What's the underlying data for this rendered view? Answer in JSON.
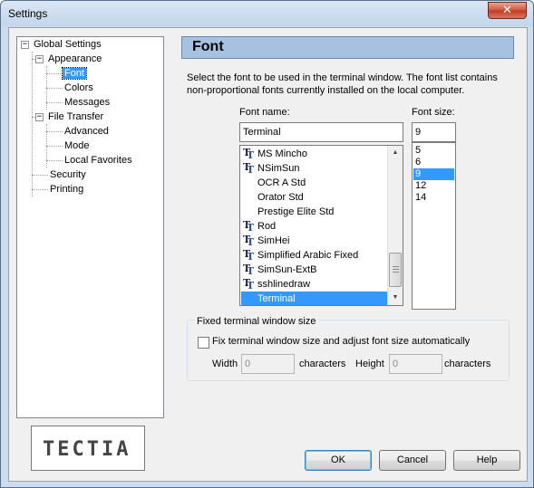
{
  "window": {
    "title": "Settings",
    "close_glyph": "✕"
  },
  "tree": {
    "items": [
      {
        "label": "Global Settings",
        "expander": "−"
      },
      {
        "label": "Appearance",
        "expander": "−"
      },
      {
        "label": "Font"
      },
      {
        "label": "Colors"
      },
      {
        "label": "Messages"
      },
      {
        "label": "File Transfer",
        "expander": "−"
      },
      {
        "label": "Advanced"
      },
      {
        "label": "Mode"
      },
      {
        "label": "Local Favorites"
      },
      {
        "label": "Security"
      },
      {
        "label": "Printing"
      }
    ],
    "selected": "Font"
  },
  "logo": {
    "text": "TECTIA"
  },
  "header": {
    "title": "Font"
  },
  "description": "Select the font to be used in the terminal window. The font list contains non-proportional fonts currently installed on the local computer.",
  "font_name": {
    "label": "Font name:",
    "value": "Terminal",
    "items": [
      {
        "name": "MS Mincho",
        "truetype": true
      },
      {
        "name": "NSimSun",
        "truetype": true
      },
      {
        "name": "OCR A Std",
        "truetype": false
      },
      {
        "name": "Orator Std",
        "truetype": false
      },
      {
        "name": "Prestige Elite Std",
        "truetype": false
      },
      {
        "name": "Rod",
        "truetype": true
      },
      {
        "name": "SimHei",
        "truetype": true
      },
      {
        "name": "Simplified Arabic Fixed",
        "truetype": true
      },
      {
        "name": "SimSun-ExtB",
        "truetype": true
      },
      {
        "name": "sshlinedraw",
        "truetype": true
      },
      {
        "name": "Terminal",
        "truetype": false
      }
    ],
    "selected": "Terminal"
  },
  "font_size": {
    "label": "Font size:",
    "value": "9",
    "items": [
      "5",
      "6",
      "9",
      "12",
      "14"
    ],
    "selected": "9"
  },
  "fixed_size": {
    "group_title": "Fixed terminal window size",
    "checkbox_label": "Fix terminal window size and adjust font size automatically",
    "checked": false,
    "width_label": "Width",
    "width_value": "0",
    "width_unit": "characters",
    "height_label": "Height",
    "height_value": "0",
    "height_unit": "characters"
  },
  "buttons": {
    "ok": "OK",
    "cancel": "Cancel",
    "help": "Help"
  },
  "colors": {
    "selection": "#3399ff",
    "header_bg": "#a6c2e0"
  }
}
